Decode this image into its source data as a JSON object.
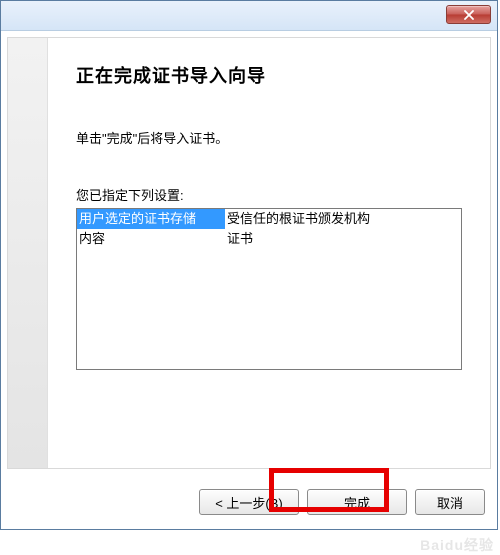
{
  "titlebar": {
    "close_icon": "close"
  },
  "wizard": {
    "heading": "正在完成证书导入向导",
    "instruction": "单击\"完成\"后将导入证书。",
    "list_label": "您已指定下列设置:",
    "rows": [
      {
        "setting": "用户选定的证书存储",
        "value": "受信任的根证书颁发机构",
        "selected": true
      },
      {
        "setting": "内容",
        "value": "证书",
        "selected": false
      }
    ]
  },
  "buttons": {
    "back": "< 上一步(B)",
    "finish": "完成",
    "cancel": "取消"
  },
  "watermark": "Baidu经验"
}
